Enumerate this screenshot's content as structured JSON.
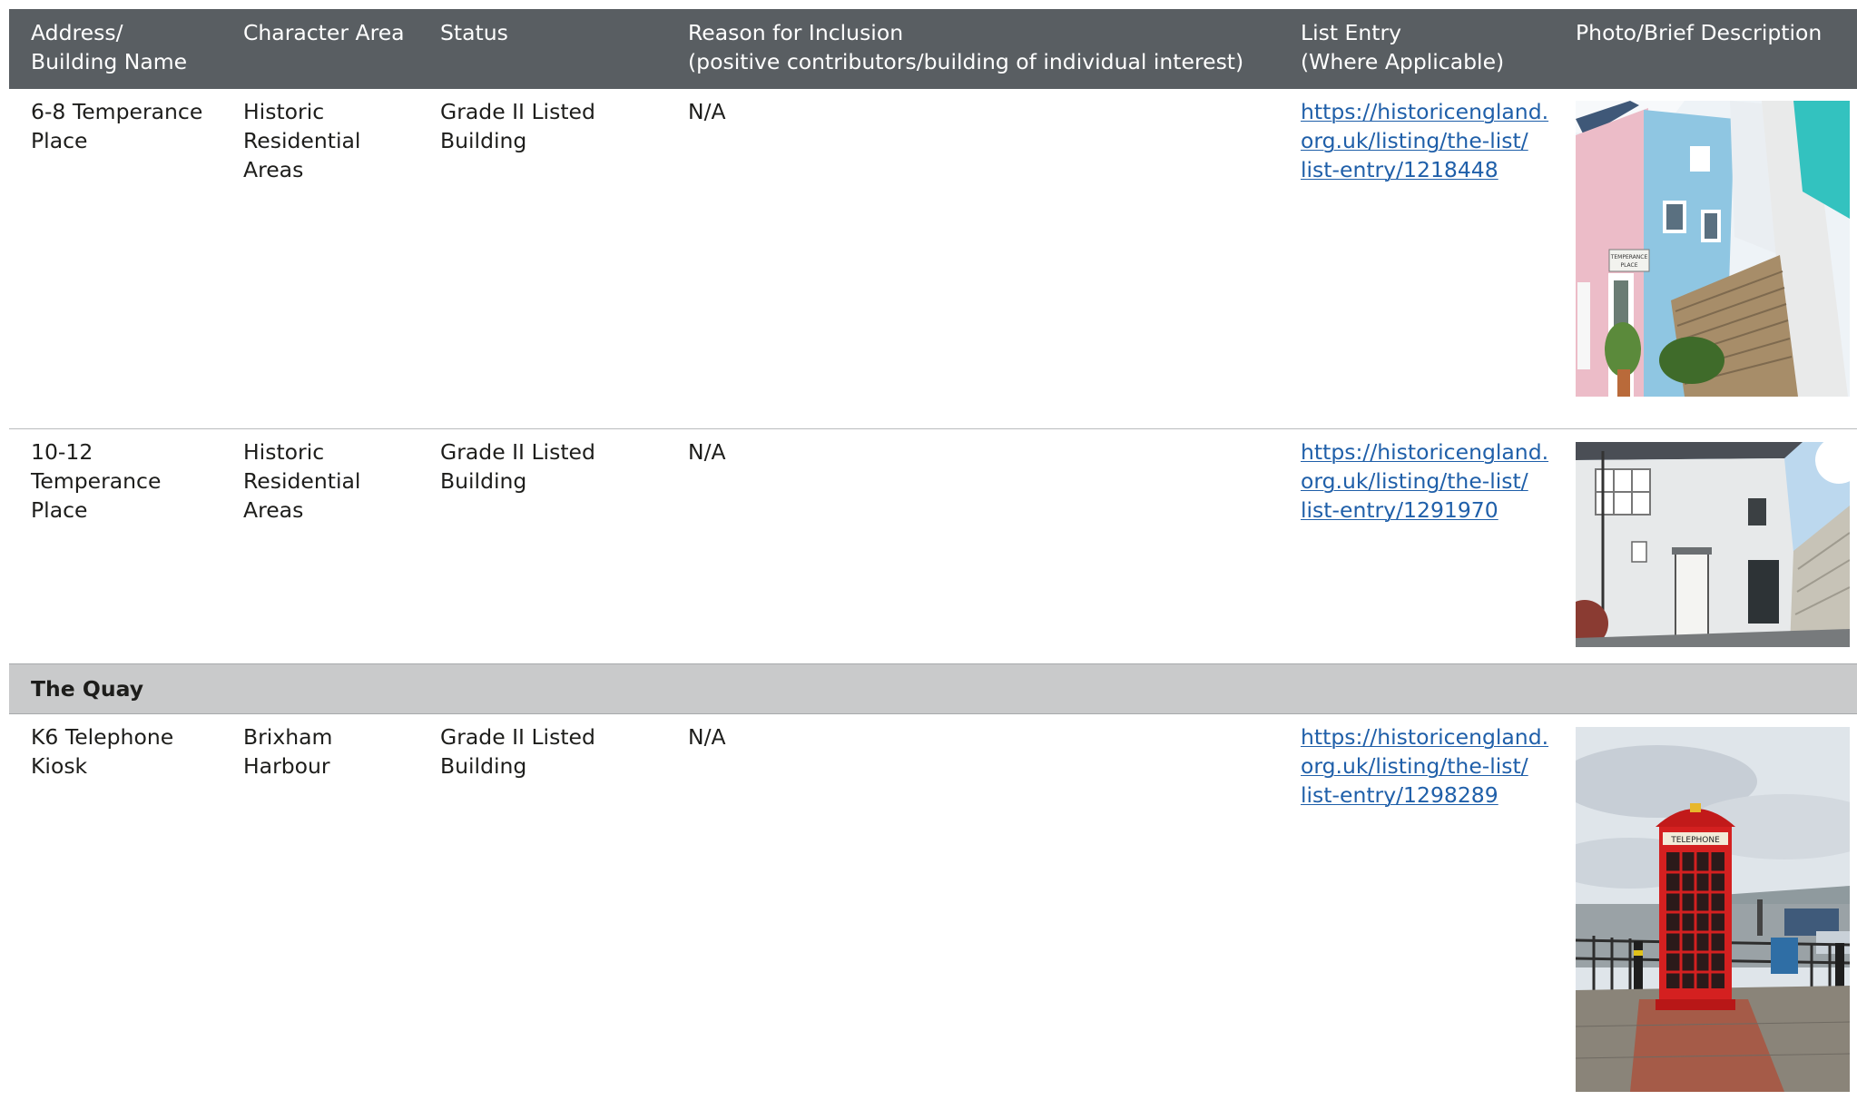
{
  "header": {
    "address": "Address/\nBuilding Name",
    "character_area": "Character Area",
    "status": "Status",
    "reason": "Reason for Inclusion\n(positive contributors/building of individual interest)",
    "list_entry": "List Entry\n(Where Applicable)",
    "photo": "Photo/Brief Description"
  },
  "rows": [
    {
      "address": "6-8 Temperance\nPlace",
      "character_area": "Historic\nResidential\nAreas",
      "status": "Grade II Listed\nBuilding",
      "reason": "N/A",
      "list_entry": "https://historicengland.\norg.uk/listing/the-list/\nlist-entry/1218448",
      "photo_sign": "TEMPERANCE\nPLACE"
    },
    {
      "address": "10-12\nTemperance\nPlace",
      "character_area": "Historic\nResidential\nAreas",
      "status": "Grade II Listed\nBuilding",
      "reason": "N/A",
      "list_entry": "https://historicengland.\norg.uk/listing/the-list/\nlist-entry/1291970"
    }
  ],
  "group": {
    "label": "The Quay"
  },
  "group_rows": [
    {
      "address": "K6 Telephone\nKiosk",
      "character_area": "Brixham\nHarbour",
      "status": "Grade II Listed\nBuilding",
      "reason": "N/A",
      "list_entry": "https://historicengland.\norg.uk/listing/the-list/\nlist-entry/1298289",
      "photo_sign": "TELEPHONE"
    }
  ],
  "colors": {
    "header_bg": "#595e62",
    "group_bg": "#c9cacb",
    "link": "#1f5fa9",
    "kiosk_red": "#d42020"
  }
}
